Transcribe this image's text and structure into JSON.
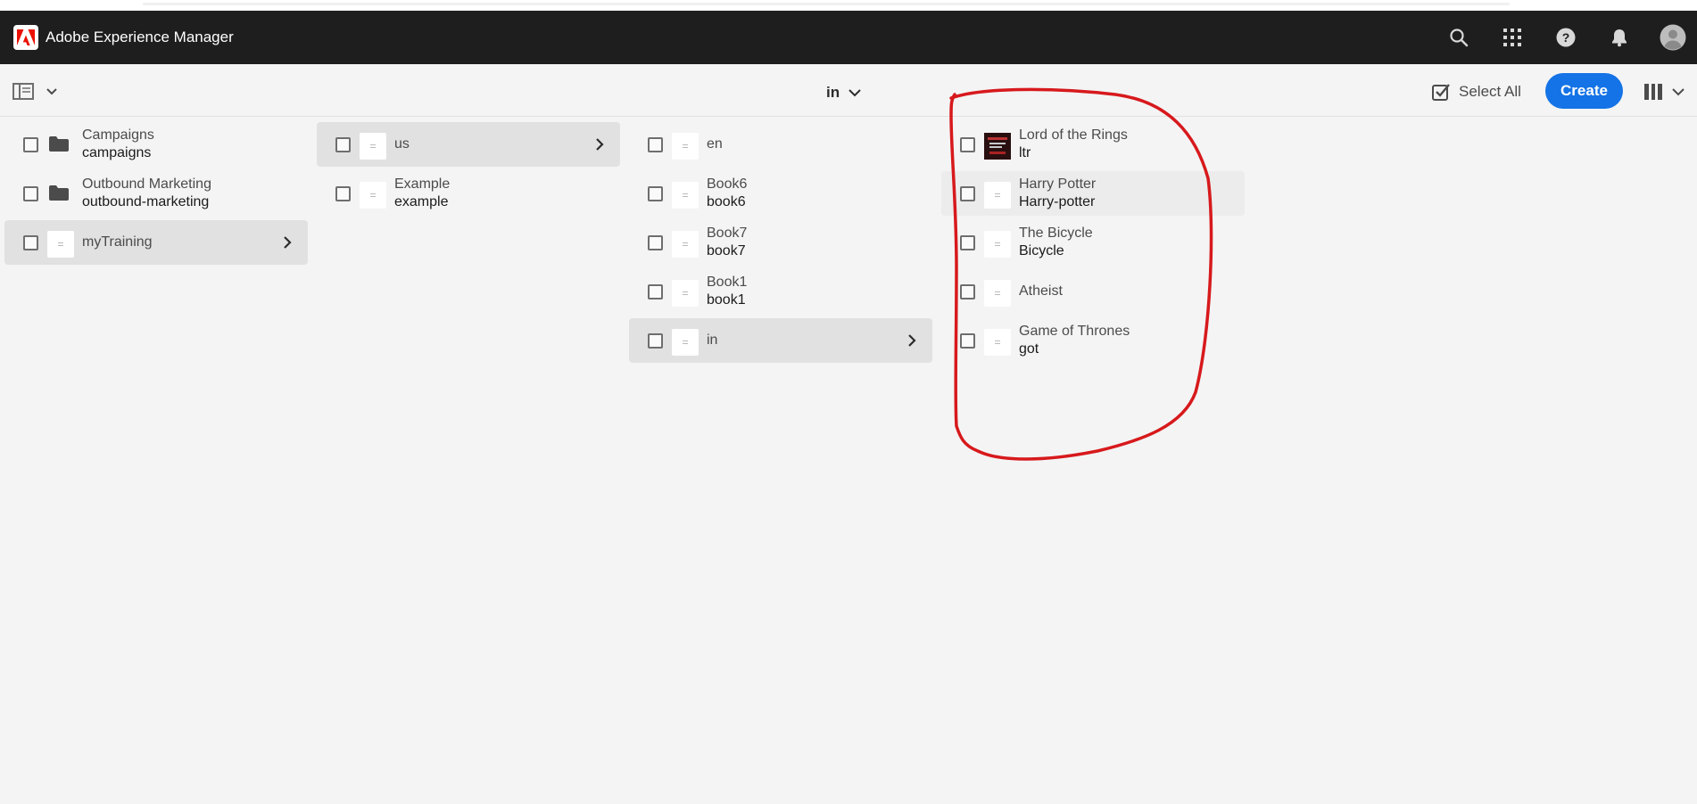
{
  "shell": {
    "title": "Adobe Experience Manager",
    "icons": [
      "search-icon",
      "apps-grid-icon",
      "help-icon",
      "bell-icon",
      "avatar"
    ],
    "background": "#1e1e1e",
    "brand_color": "#eb1000"
  },
  "actionbar": {
    "breadcrumb": "in",
    "select_all_label": "Select All",
    "create_label": "Create",
    "accent": "#1473e6"
  },
  "columns": [
    {
      "items": [
        {
          "title": "Campaigns",
          "name": "campaigns",
          "icon": "folder-icon"
        },
        {
          "title": "Outbound Marketing",
          "name": "outbound-marketing",
          "icon": "folder-icon"
        },
        {
          "title": "myTraining",
          "icon": "page-icon",
          "active": true,
          "expandable": true
        }
      ]
    },
    {
      "items": [
        {
          "title": "us",
          "icon": "page-icon",
          "active": true,
          "expandable": true
        },
        {
          "title": "Example",
          "name": "example",
          "icon": "page-icon"
        }
      ]
    },
    {
      "items": [
        {
          "title": "en",
          "icon": "page-icon"
        },
        {
          "title": "Book6",
          "name": "book6",
          "icon": "page-icon"
        },
        {
          "title": "Book7",
          "name": "book7",
          "icon": "page-icon"
        },
        {
          "title": "Book1",
          "name": "book1",
          "icon": "page-icon"
        },
        {
          "title": "in",
          "icon": "page-icon",
          "active": true,
          "expandable": true
        }
      ]
    },
    {
      "items": [
        {
          "title": "Lord of the Rings",
          "name": "ltr",
          "icon": "book-cover-thumbnail"
        },
        {
          "title": "Harry Potter",
          "name": "Harry-potter",
          "icon": "page-icon",
          "hover": true
        },
        {
          "title": "The Bicycle",
          "name": "Bicycle",
          "icon": "page-icon"
        },
        {
          "title": "Atheist",
          "icon": "page-icon"
        },
        {
          "title": "Game of Thrones",
          "name": "got",
          "icon": "page-icon"
        }
      ]
    }
  ],
  "annotation": {
    "shape": "hand-drawn circle",
    "color": "#d7191c"
  }
}
